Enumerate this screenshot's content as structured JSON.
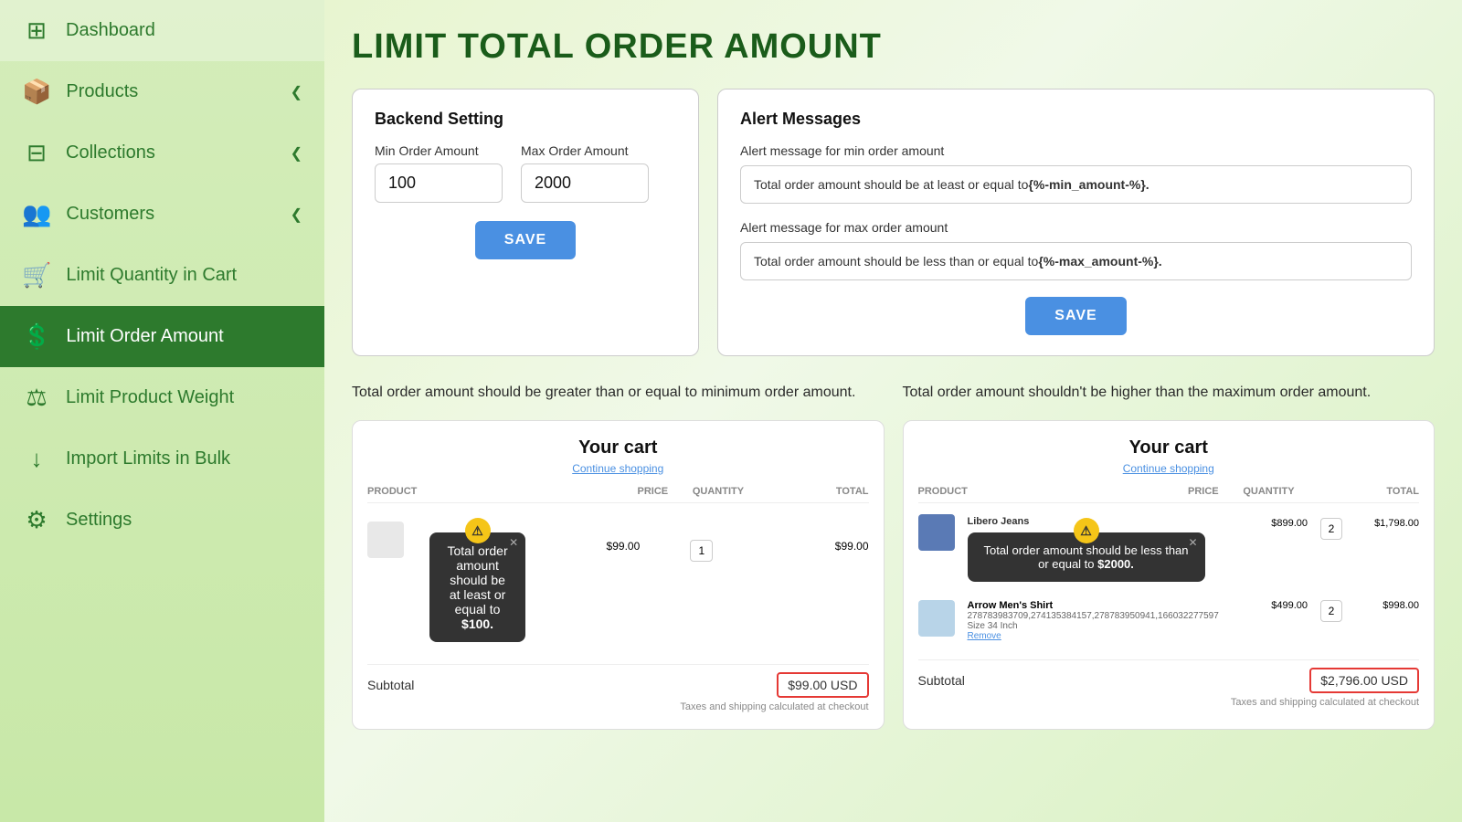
{
  "sidebar": {
    "items": [
      {
        "id": "dashboard",
        "label": "Dashboard",
        "icon": "⊞",
        "active": false,
        "hasChevron": false
      },
      {
        "id": "products",
        "label": "Products",
        "icon": "📦",
        "active": false,
        "hasChevron": true
      },
      {
        "id": "collections",
        "label": "Collections",
        "icon": "⊟",
        "active": false,
        "hasChevron": true
      },
      {
        "id": "customers",
        "label": "Customers",
        "icon": "👥",
        "active": false,
        "hasChevron": true
      },
      {
        "id": "limit-quantity",
        "label": "Limit Quantity in Cart",
        "icon": "🛒",
        "active": false,
        "hasChevron": false
      },
      {
        "id": "limit-order",
        "label": "Limit Order Amount",
        "icon": "💲",
        "active": true,
        "hasChevron": false
      },
      {
        "id": "limit-weight",
        "label": "Limit Product Weight",
        "icon": "⚖",
        "active": false,
        "hasChevron": false
      },
      {
        "id": "import-limits",
        "label": "Import Limits in Bulk",
        "icon": "↓",
        "active": false,
        "hasChevron": false
      },
      {
        "id": "settings",
        "label": "Settings",
        "icon": "⚙",
        "active": false,
        "hasChevron": false
      }
    ]
  },
  "page": {
    "title": "LIMIT TOTAL ORDER AMOUNT",
    "backend_card": {
      "title": "Backend Setting",
      "min_label": "Min Order Amount",
      "max_label": "Max Order Amount",
      "min_value": "100",
      "max_value": "2000",
      "save_btn": "SAVE"
    },
    "alert_card": {
      "title": "Alert Messages",
      "min_alert_label": "Alert message for min order amount",
      "min_alert_text": "Total order amount should be at least or equal to ",
      "min_alert_var": "{%-min_amount-%}.",
      "max_alert_label": "Alert message for max order amount",
      "max_alert_text": "Total order amount should be less than or equal to ",
      "max_alert_var": "{%-max_amount-%}.",
      "save_btn": "SAVE"
    },
    "left_desc": "Total order amount should be greater than or equal to minimum order amount.",
    "right_desc": "Total order amount shouldn't be higher than the maximum order amount.",
    "left_cart": {
      "title": "Your cart",
      "continue": "Continue shopping",
      "product_col": "PRODUCT",
      "price_col": "PRICE",
      "qty_col": "QUANTITY",
      "total_col": "TOTAL",
      "tooltip_text": "Total order amount should be at least or equal to ",
      "tooltip_amount": "$100.",
      "product_price": "$99.00",
      "product_qty": "1",
      "product_total": "$99.00",
      "subtotal_label": "Subtotal",
      "subtotal_value": "$99.00 USD",
      "taxes_note": "Taxes and shipping calculated at checkout"
    },
    "right_cart": {
      "title": "Your cart",
      "continue": "Continue shopping",
      "product_col": "PRODUCT",
      "price_col": "PRICE",
      "qty_col": "QUANTITY",
      "total_col": "TOTAL",
      "tooltip_text": "Total order amount should be less than or equal to ",
      "tooltip_amount": "$2000.",
      "product1_name": "Libero Jeans",
      "product1_price": "$899.00",
      "product1_qty": "2",
      "product1_total": "$1,798.00",
      "product2_name": "Arrow Men's Shirt",
      "product2_variant": "278783983709,274135384157,278783950941,166032277597",
      "product2_size": "Size 34 Inch",
      "product2_remove": "Remove",
      "product2_price": "$499.00",
      "product2_qty": "2",
      "product2_total": "$998.00",
      "subtotal_label": "Subtotal",
      "subtotal_value": "$2,796.00 USD",
      "taxes_note": "Taxes and shipping calculated at checkout"
    }
  }
}
